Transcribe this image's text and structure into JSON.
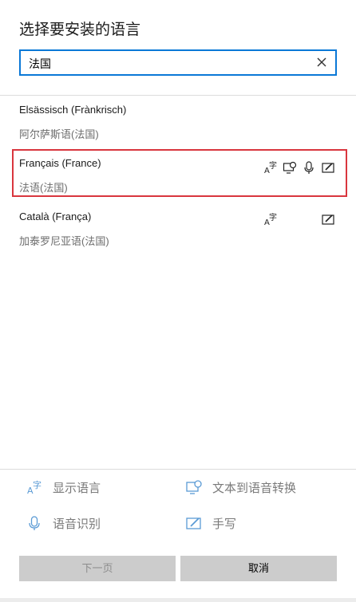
{
  "dialog": {
    "title": "选择要安装的语言"
  },
  "search": {
    "value": "法国"
  },
  "languages": [
    {
      "name": "Elsässisch (Frànkrisch)",
      "native": "阿尔萨斯语(法国)",
      "features": []
    },
    {
      "name": "Français (France)",
      "native": "法语(法国)",
      "features": [
        "display-language-icon",
        "text-to-speech-icon",
        "speech-recognition-icon",
        "handwriting-icon"
      ],
      "selected": true
    },
    {
      "name": "Català (França)",
      "native": "加泰罗尼亚语(法国)",
      "features": [
        "display-language-icon",
        "handwriting-icon"
      ]
    }
  ],
  "legend": {
    "display": "显示语言",
    "tts": "文本到语音转换",
    "speech": "语音识别",
    "handwriting": "手写"
  },
  "buttons": {
    "next": "下一页",
    "cancel": "取消"
  },
  "colors": {
    "accent": "#0a78d7",
    "selection": "#d9363e",
    "button_bg": "#cccccc"
  }
}
